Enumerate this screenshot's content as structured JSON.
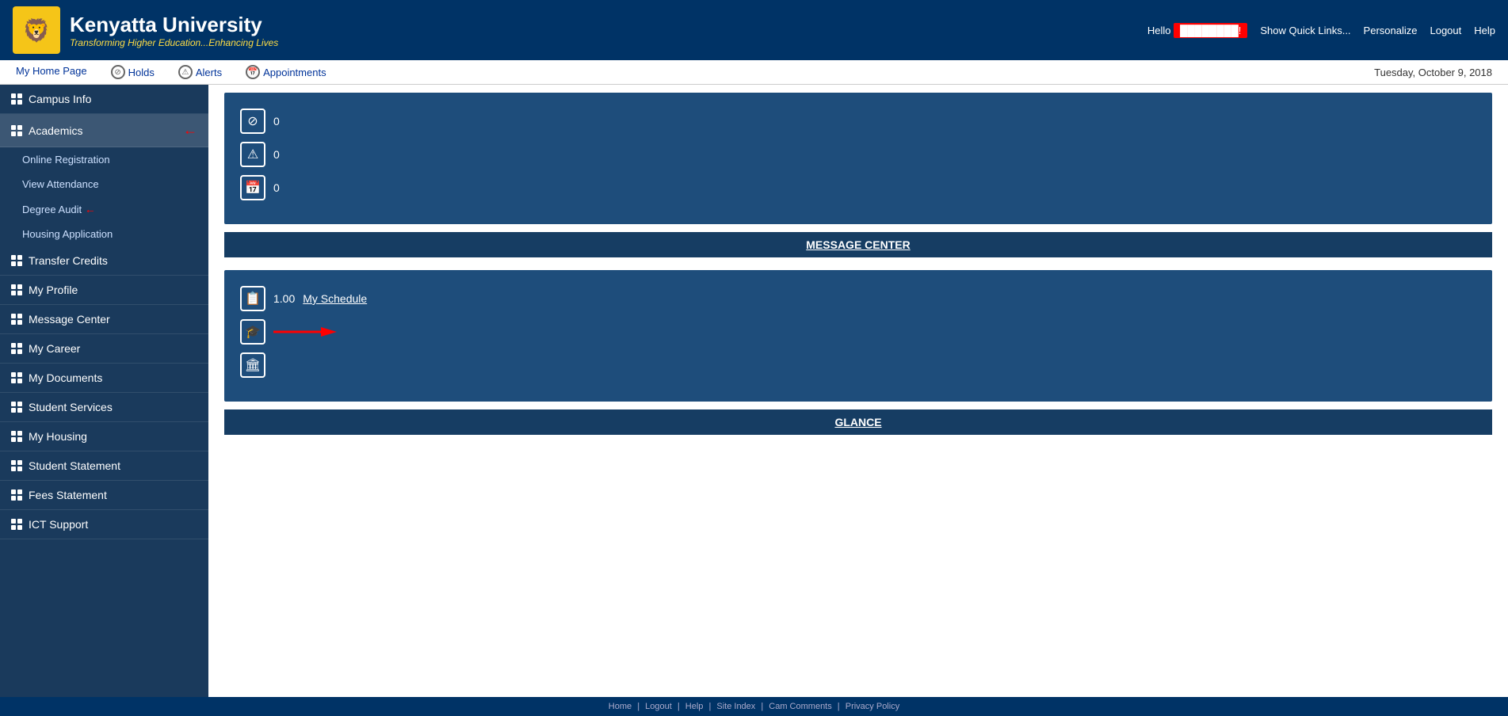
{
  "header": {
    "logo_emoji": "🦁",
    "university_name": "Kenyatta University",
    "subtitle": "Transforming Higher Education...Enhancing Lives",
    "hello_prefix": "Hello",
    "hello_name": "████████!",
    "quick_links": "Show Quick Links...",
    "personalize": "Personalize",
    "logout": "Logout",
    "help": "Help"
  },
  "navbar": {
    "home_page": "My Home Page",
    "holds": "Holds",
    "alerts": "Alerts",
    "appointments": "Appointments",
    "date": "Tuesday, October 9, 2018"
  },
  "sidebar": {
    "items": [
      {
        "id": "campus-info",
        "label": "Campus Info",
        "has_children": false
      },
      {
        "id": "academics",
        "label": "Academics",
        "has_children": true,
        "expanded": true
      },
      {
        "id": "transfer-credits",
        "label": "Transfer Credits",
        "has_children": false
      },
      {
        "id": "my-profile",
        "label": "My Profile",
        "has_children": false
      },
      {
        "id": "message-center",
        "label": "Message Center",
        "has_children": false
      },
      {
        "id": "my-career",
        "label": "My Career",
        "has_children": false
      },
      {
        "id": "my-documents",
        "label": "My Documents",
        "has_children": false
      },
      {
        "id": "student-services",
        "label": "Student Services",
        "has_children": false
      },
      {
        "id": "my-housing",
        "label": "My Housing",
        "has_children": false
      },
      {
        "id": "student-statement",
        "label": "Student Statement",
        "has_children": false
      },
      {
        "id": "fees-statement",
        "label": "Fees Statement",
        "has_children": false
      },
      {
        "id": "ict-support",
        "label": "ICT Support",
        "has_children": false
      }
    ],
    "sub_items": [
      {
        "id": "online-registration",
        "label": "Online Registration"
      },
      {
        "id": "view-attendance",
        "label": "View Attendance"
      },
      {
        "id": "degree-audit",
        "label": "Degree Audit"
      },
      {
        "id": "housing-application",
        "label": "Housing Application"
      }
    ]
  },
  "message_center": {
    "holds_count": "0",
    "alerts_count": "0",
    "appointments_count": "0",
    "footer_label": "MESSAGE CENTER"
  },
  "glance": {
    "schedule_count": "1.00",
    "schedule_link": "My Schedule",
    "footer_label": "GLANCE"
  },
  "footer": {
    "links": [
      "Home",
      "Logout",
      "Help",
      "Site Index",
      "Cam Comments",
      "Privacy Policy"
    ]
  }
}
